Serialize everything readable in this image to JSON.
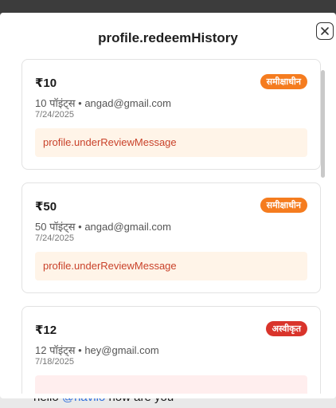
{
  "modal": {
    "title": "profile.redeemHistory",
    "close_icon": "close-icon"
  },
  "colors": {
    "pending": "#f57c1f",
    "rejected": "#d9342b",
    "pending_box_bg": "#fff4e8",
    "pending_box_text": "#c9422a",
    "rejected_box_bg": "#ffeeee"
  },
  "items": [
    {
      "amount": "₹10",
      "meta": "10 पॉइंट्स • angad@gmail.com",
      "date": "7/24/2025",
      "status": "समीक्षाधीन",
      "status_type": "pending",
      "message": "profile.underReviewMessage"
    },
    {
      "amount": "₹50",
      "meta": "50 पॉइंट्स • angad@gmail.com",
      "date": "7/24/2025",
      "status": "समीक्षाधीन",
      "status_type": "pending",
      "message": "profile.underReviewMessage"
    },
    {
      "amount": "₹12",
      "meta": "12 पॉइंट्स • hey@gmail.com",
      "date": "7/18/2025",
      "status": "अस्वीकृत",
      "status_type": "rejected",
      "message": ""
    }
  ],
  "backdrop": {
    "prefix": "hello ",
    "mention": "@navilo",
    "suffix": " how are you"
  }
}
